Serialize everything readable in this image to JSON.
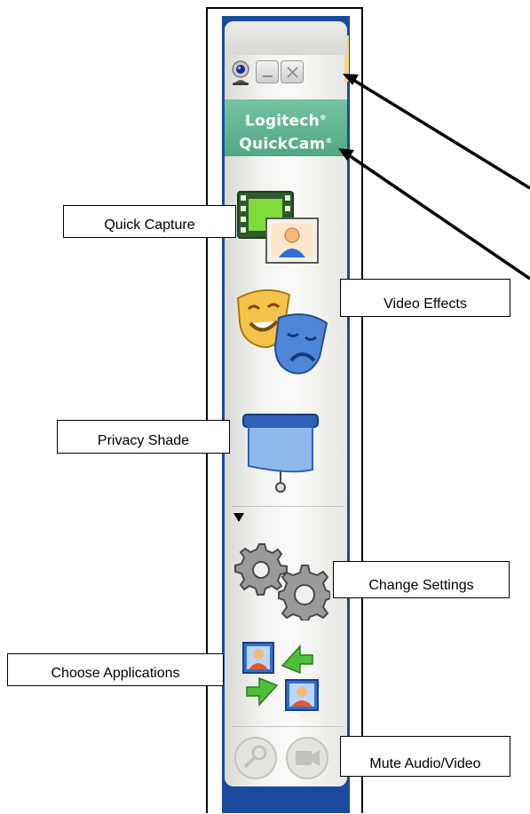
{
  "brand": {
    "line1": "Logitech",
    "line2": "QuickCam",
    "mark": "®"
  },
  "window_controls": {
    "minimize_icon": "minimize-icon",
    "close_icon": "close-icon",
    "webcam_icon": "webcam-icon"
  },
  "tools": [
    {
      "id": "quick-capture",
      "icon": "quick-capture-icon"
    },
    {
      "id": "video-effects",
      "icon": "theater-masks-icon"
    },
    {
      "id": "privacy-shade",
      "icon": "privacy-shade-icon"
    },
    {
      "id": "change-settings",
      "icon": "gears-icon"
    },
    {
      "id": "choose-applications",
      "icon": "applications-icon"
    },
    {
      "id": "mute-audio",
      "icon": "microphone-icon"
    },
    {
      "id": "mute-video",
      "icon": "video-camera-icon"
    }
  ],
  "callouts": {
    "quick_capture": "Quick Capture",
    "video_effects": "Video Effects",
    "privacy_shade": "Privacy Shade",
    "change_settings": "Change Settings",
    "choose_applications": "Choose Applications",
    "mute_audio_video": "Mute Audio/Video"
  },
  "colors": {
    "brand_green": "#5cb48e",
    "window_blue": "#1a4a9e",
    "toolbar_bg": "#f3f3f1"
  }
}
